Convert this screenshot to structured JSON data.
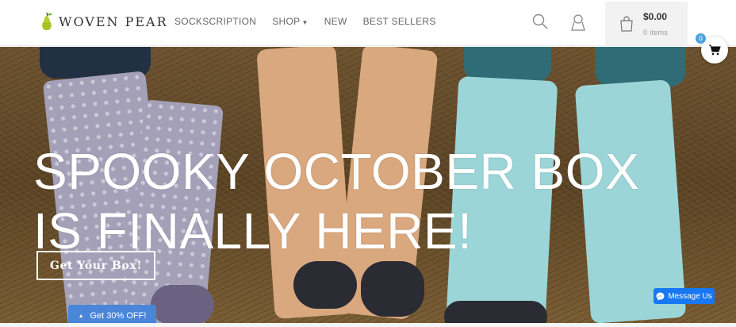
{
  "brand": {
    "name": "WOVEN PEAR"
  },
  "nav": {
    "items": [
      {
        "label": "SOCKSCRIPTION"
      },
      {
        "label": "SHOP",
        "has_dropdown": true
      },
      {
        "label": "NEW"
      },
      {
        "label": "BEST SELLERS"
      }
    ]
  },
  "header_icons": {
    "search": "search-icon",
    "account": "account-icon"
  },
  "cart": {
    "amount": "$0.00",
    "items": "0 items"
  },
  "floating_cart": {
    "count": "0"
  },
  "hero": {
    "title_line1": "SPOOKY OCTOBER BOX",
    "title_line2": "IS FINALLY HERE!",
    "cta_label": "Get Your Box!"
  },
  "promo": {
    "label": "Get 30% OFF!"
  },
  "messenger": {
    "label": "Message Us"
  },
  "colors": {
    "accent": "#4a86d8",
    "messenger": "#1877f2",
    "badge": "#4aa3df"
  }
}
